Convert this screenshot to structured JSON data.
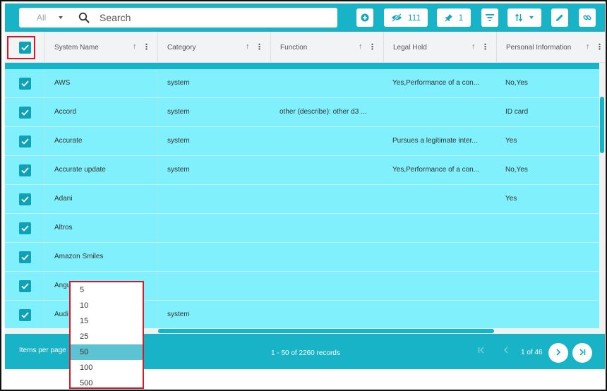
{
  "search": {
    "scope_label": "All",
    "placeholder": "Search",
    "value": ""
  },
  "toolbar": {
    "hidden_count": "111",
    "pinned_count": "1"
  },
  "columns": [
    "System Name",
    "Category",
    "Function",
    "Legal Hold",
    "Personal Information"
  ],
  "rows": [
    {
      "name": "AWS",
      "category": "system",
      "function": "",
      "legal_hold": "Yes,Performance of a con...",
      "personal_info": "No,Yes"
    },
    {
      "name": "Accord",
      "category": "system",
      "function": "other (describe): other d3 ...",
      "legal_hold": "",
      "personal_info": "ID card"
    },
    {
      "name": "Accurate",
      "category": "system",
      "function": "",
      "legal_hold": "Pursues a legitimate inter...",
      "personal_info": "Yes"
    },
    {
      "name": "Accurate update",
      "category": "system",
      "function": "",
      "legal_hold": "Yes,Performance of a con...",
      "personal_info": "No,Yes"
    },
    {
      "name": "Adani",
      "category": "",
      "function": "",
      "legal_hold": "",
      "personal_info": "Yes"
    },
    {
      "name": "Altros",
      "category": "",
      "function": "",
      "legal_hold": "",
      "personal_info": ""
    },
    {
      "name": "Amazon Smiles",
      "category": "",
      "function": "",
      "legal_hold": "",
      "personal_info": ""
    },
    {
      "name": "Angu",
      "category": "",
      "function": "",
      "legal_hold": "",
      "personal_info": ""
    },
    {
      "name": "Audi",
      "category": "system",
      "function": "",
      "legal_hold": "",
      "personal_info": ""
    }
  ],
  "footer": {
    "items_per_page_label": "Items per page",
    "records_label": "1 - 50 of 2260 records",
    "page_label": "1 of 46"
  },
  "page_size_options": [
    "5",
    "10",
    "15",
    "25",
    "50",
    "100",
    "500"
  ],
  "page_size_selected": "50",
  "colors": {
    "accent": "#19b3c8",
    "selected_row": "#80f0fc",
    "highlight_border": "#d11a2a"
  }
}
